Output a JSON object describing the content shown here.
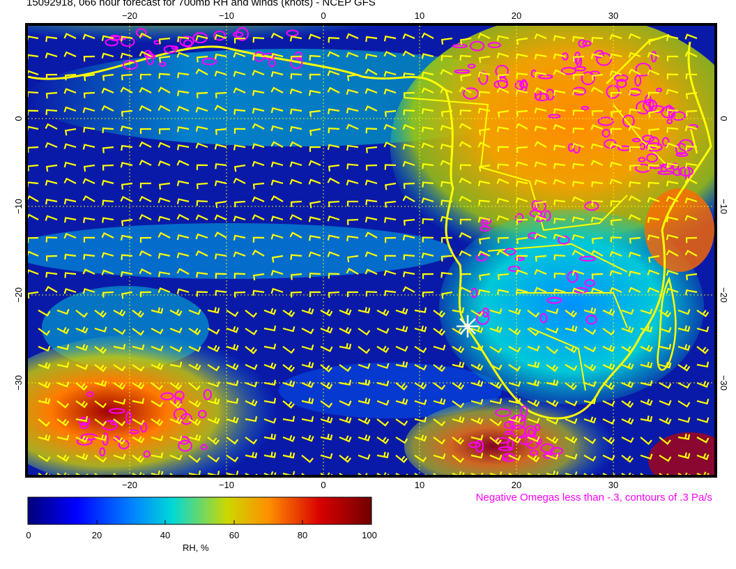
{
  "title": "15092918, 066 hour forecast for 700mb RH and winds (knots) - NCEP GFS",
  "map": {
    "top_lon_ticks": [
      "−20",
      "−10",
      "0",
      "10",
      "20",
      "30"
    ],
    "bottom_lon_ticks": [
      "−20",
      "−10",
      "0",
      "10",
      "20",
      "30"
    ],
    "left_lat_ticks": [
      "0",
      "−10",
      "−20",
      "−30"
    ],
    "right_lat_ticks": [
      "0",
      "−10",
      "−20",
      "−30"
    ],
    "omega_contour_color": "#ff00ff",
    "barb_and_coast_color": "#ffff00",
    "gridline_color": "#ffff00",
    "marker": "star"
  },
  "omega_note": "Negative Omegas less than -.3, contours of .3 Pa/s",
  "colorbar": {
    "label": "RH, %",
    "ticks": [
      "0",
      "20",
      "40",
      "60",
      "80",
      "100"
    ],
    "colors": [
      "#00007a",
      "#0000ff",
      "#0080ff",
      "#00d8d8",
      "#ccd800",
      "#ff9000",
      "#d80000",
      "#700000"
    ]
  }
}
